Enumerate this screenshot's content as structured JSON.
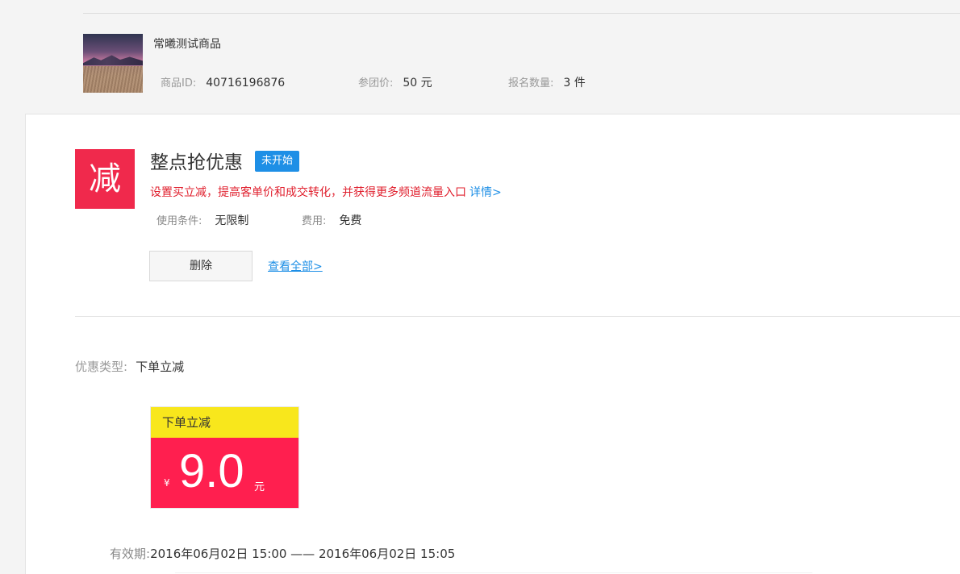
{
  "product": {
    "name": "常曦测试商品",
    "id_label": "商品ID:",
    "id_value": "40716196876",
    "price_label": "参团价:",
    "price_value": "50 元",
    "qty_label": "报名数量:",
    "qty_value": "3 件"
  },
  "promo": {
    "icon_char": "减",
    "title": "整点抢优惠",
    "status": "未开始",
    "description": "设置买立减，提高客单价和成交转化，并获得更多频道流量入口",
    "detail_link": "详情>",
    "condition_label": "使用条件:",
    "condition_value": "无限制",
    "fee_label": "费用:",
    "fee_value": "免费",
    "delete_label": "删除",
    "view_all_label": "查看全部>"
  },
  "discount": {
    "type_label": "优惠类型:",
    "type_value": "下单立减",
    "coupon_title": "下单立减",
    "currency": "¥",
    "amount": "9.0",
    "unit": "元",
    "validity_label": "有效期:",
    "validity_value": "2016年06月02日 15:00 —— 2016年06月02日 15:05"
  },
  "colors": {
    "brand_red": "#f0294c",
    "badge_blue": "#1e8fe6",
    "coupon_yellow": "#f8e71c",
    "coupon_red": "#ff1f4f"
  }
}
